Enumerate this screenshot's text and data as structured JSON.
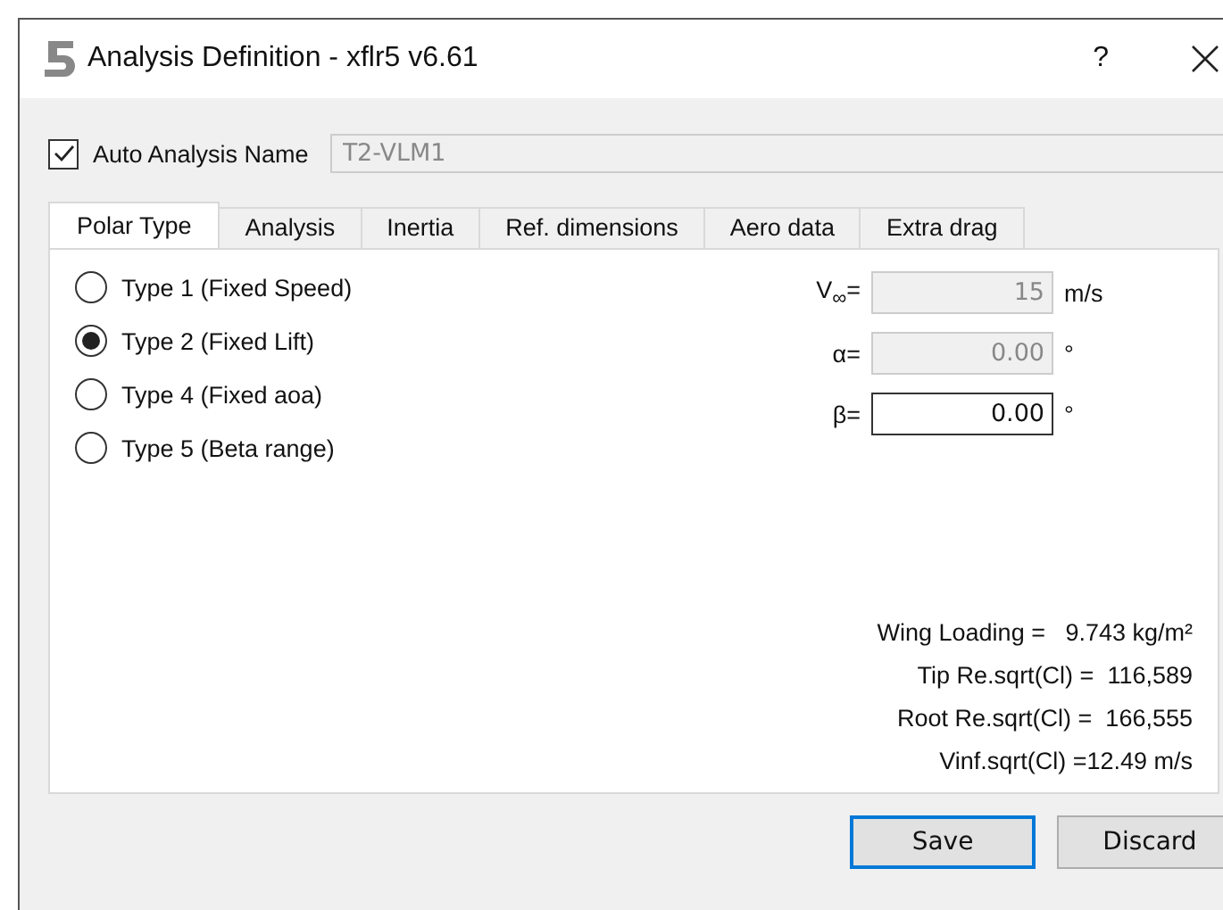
{
  "window": {
    "title": "Analysis Definition - xflr5 v6.61",
    "help": "?"
  },
  "auto_name": {
    "label": "Auto Analysis Name",
    "checked": true,
    "value": "T2-VLM1",
    "disabled": true
  },
  "tabs": [
    {
      "label": "Polar Type",
      "selected": true
    },
    {
      "label": "Analysis",
      "selected": false
    },
    {
      "label": "Inertia",
      "selected": false
    },
    {
      "label": "Ref. dimensions",
      "selected": false
    },
    {
      "label": "Aero data",
      "selected": false
    },
    {
      "label": "Extra drag",
      "selected": false
    }
  ],
  "polar_types": [
    {
      "label": "Type 1 (Fixed Speed)",
      "selected": false
    },
    {
      "label": "Type 2 (Fixed Lift)",
      "selected": true
    },
    {
      "label": "Type 4 (Fixed aoa)",
      "selected": false
    },
    {
      "label": "Type 5 (Beta range)",
      "selected": false
    }
  ],
  "parameters": [
    {
      "label": "V$_{∞}$=",
      "value": "15",
      "unit": "m/s",
      "disabled": true
    },
    {
      "label": "α=",
      "value": "0.00",
      "unit": "°",
      "disabled": true
    },
    {
      "label": "β=",
      "value": "0.00",
      "unit": "°",
      "disabled": false
    }
  ],
  "results": [
    "Wing Loading =   9.743 kg/m²",
    "Tip Re.sqrt(Cl) =  116,589",
    "Root Re.sqrt(Cl) =  166,555",
    "Vinf.sqrt(Cl) =12.49 m/s"
  ],
  "buttons": [
    {
      "label": "Save",
      "selected": true
    },
    {
      "label": "Discard",
      "selected": false
    }
  ]
}
